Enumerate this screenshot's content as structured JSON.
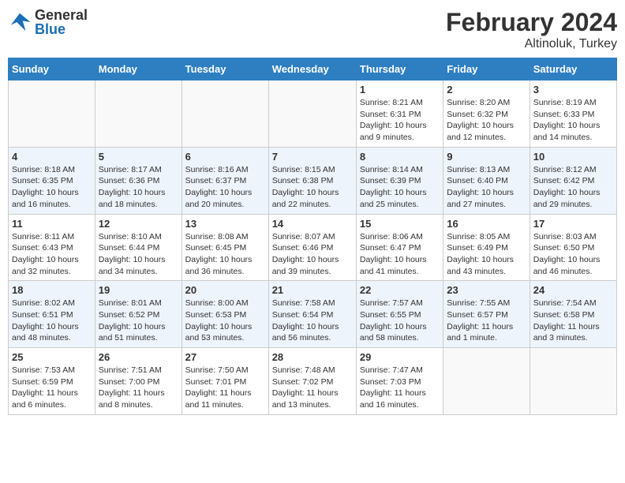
{
  "header": {
    "logo": {
      "general": "General",
      "blue": "Blue"
    },
    "title": "February 2024",
    "location": "Altinoluk, Turkey"
  },
  "days_of_week": [
    "Sunday",
    "Monday",
    "Tuesday",
    "Wednesday",
    "Thursday",
    "Friday",
    "Saturday"
  ],
  "weeks": [
    {
      "days": [
        {
          "num": "",
          "info": ""
        },
        {
          "num": "",
          "info": ""
        },
        {
          "num": "",
          "info": ""
        },
        {
          "num": "",
          "info": ""
        },
        {
          "num": "1",
          "info": "Sunrise: 8:21 AM\nSunset: 6:31 PM\nDaylight: 10 hours\nand 9 minutes."
        },
        {
          "num": "2",
          "info": "Sunrise: 8:20 AM\nSunset: 6:32 PM\nDaylight: 10 hours\nand 12 minutes."
        },
        {
          "num": "3",
          "info": "Sunrise: 8:19 AM\nSunset: 6:33 PM\nDaylight: 10 hours\nand 14 minutes."
        }
      ]
    },
    {
      "days": [
        {
          "num": "4",
          "info": "Sunrise: 8:18 AM\nSunset: 6:35 PM\nDaylight: 10 hours\nand 16 minutes."
        },
        {
          "num": "5",
          "info": "Sunrise: 8:17 AM\nSunset: 6:36 PM\nDaylight: 10 hours\nand 18 minutes."
        },
        {
          "num": "6",
          "info": "Sunrise: 8:16 AM\nSunset: 6:37 PM\nDaylight: 10 hours\nand 20 minutes."
        },
        {
          "num": "7",
          "info": "Sunrise: 8:15 AM\nSunset: 6:38 PM\nDaylight: 10 hours\nand 22 minutes."
        },
        {
          "num": "8",
          "info": "Sunrise: 8:14 AM\nSunset: 6:39 PM\nDaylight: 10 hours\nand 25 minutes."
        },
        {
          "num": "9",
          "info": "Sunrise: 8:13 AM\nSunset: 6:40 PM\nDaylight: 10 hours\nand 27 minutes."
        },
        {
          "num": "10",
          "info": "Sunrise: 8:12 AM\nSunset: 6:42 PM\nDaylight: 10 hours\nand 29 minutes."
        }
      ]
    },
    {
      "days": [
        {
          "num": "11",
          "info": "Sunrise: 8:11 AM\nSunset: 6:43 PM\nDaylight: 10 hours\nand 32 minutes."
        },
        {
          "num": "12",
          "info": "Sunrise: 8:10 AM\nSunset: 6:44 PM\nDaylight: 10 hours\nand 34 minutes."
        },
        {
          "num": "13",
          "info": "Sunrise: 8:08 AM\nSunset: 6:45 PM\nDaylight: 10 hours\nand 36 minutes."
        },
        {
          "num": "14",
          "info": "Sunrise: 8:07 AM\nSunset: 6:46 PM\nDaylight: 10 hours\nand 39 minutes."
        },
        {
          "num": "15",
          "info": "Sunrise: 8:06 AM\nSunset: 6:47 PM\nDaylight: 10 hours\nand 41 minutes."
        },
        {
          "num": "16",
          "info": "Sunrise: 8:05 AM\nSunset: 6:49 PM\nDaylight: 10 hours\nand 43 minutes."
        },
        {
          "num": "17",
          "info": "Sunrise: 8:03 AM\nSunset: 6:50 PM\nDaylight: 10 hours\nand 46 minutes."
        }
      ]
    },
    {
      "days": [
        {
          "num": "18",
          "info": "Sunrise: 8:02 AM\nSunset: 6:51 PM\nDaylight: 10 hours\nand 48 minutes."
        },
        {
          "num": "19",
          "info": "Sunrise: 8:01 AM\nSunset: 6:52 PM\nDaylight: 10 hours\nand 51 minutes."
        },
        {
          "num": "20",
          "info": "Sunrise: 8:00 AM\nSunset: 6:53 PM\nDaylight: 10 hours\nand 53 minutes."
        },
        {
          "num": "21",
          "info": "Sunrise: 7:58 AM\nSunset: 6:54 PM\nDaylight: 10 hours\nand 56 minutes."
        },
        {
          "num": "22",
          "info": "Sunrise: 7:57 AM\nSunset: 6:55 PM\nDaylight: 10 hours\nand 58 minutes."
        },
        {
          "num": "23",
          "info": "Sunrise: 7:55 AM\nSunset: 6:57 PM\nDaylight: 11 hours\nand 1 minute."
        },
        {
          "num": "24",
          "info": "Sunrise: 7:54 AM\nSunset: 6:58 PM\nDaylight: 11 hours\nand 3 minutes."
        }
      ]
    },
    {
      "days": [
        {
          "num": "25",
          "info": "Sunrise: 7:53 AM\nSunset: 6:59 PM\nDaylight: 11 hours\nand 6 minutes."
        },
        {
          "num": "26",
          "info": "Sunrise: 7:51 AM\nSunset: 7:00 PM\nDaylight: 11 hours\nand 8 minutes."
        },
        {
          "num": "27",
          "info": "Sunrise: 7:50 AM\nSunset: 7:01 PM\nDaylight: 11 hours\nand 11 minutes."
        },
        {
          "num": "28",
          "info": "Sunrise: 7:48 AM\nSunset: 7:02 PM\nDaylight: 11 hours\nand 13 minutes."
        },
        {
          "num": "29",
          "info": "Sunrise: 7:47 AM\nSunset: 7:03 PM\nDaylight: 11 hours\nand 16 minutes."
        },
        {
          "num": "",
          "info": ""
        },
        {
          "num": "",
          "info": ""
        }
      ]
    }
  ]
}
